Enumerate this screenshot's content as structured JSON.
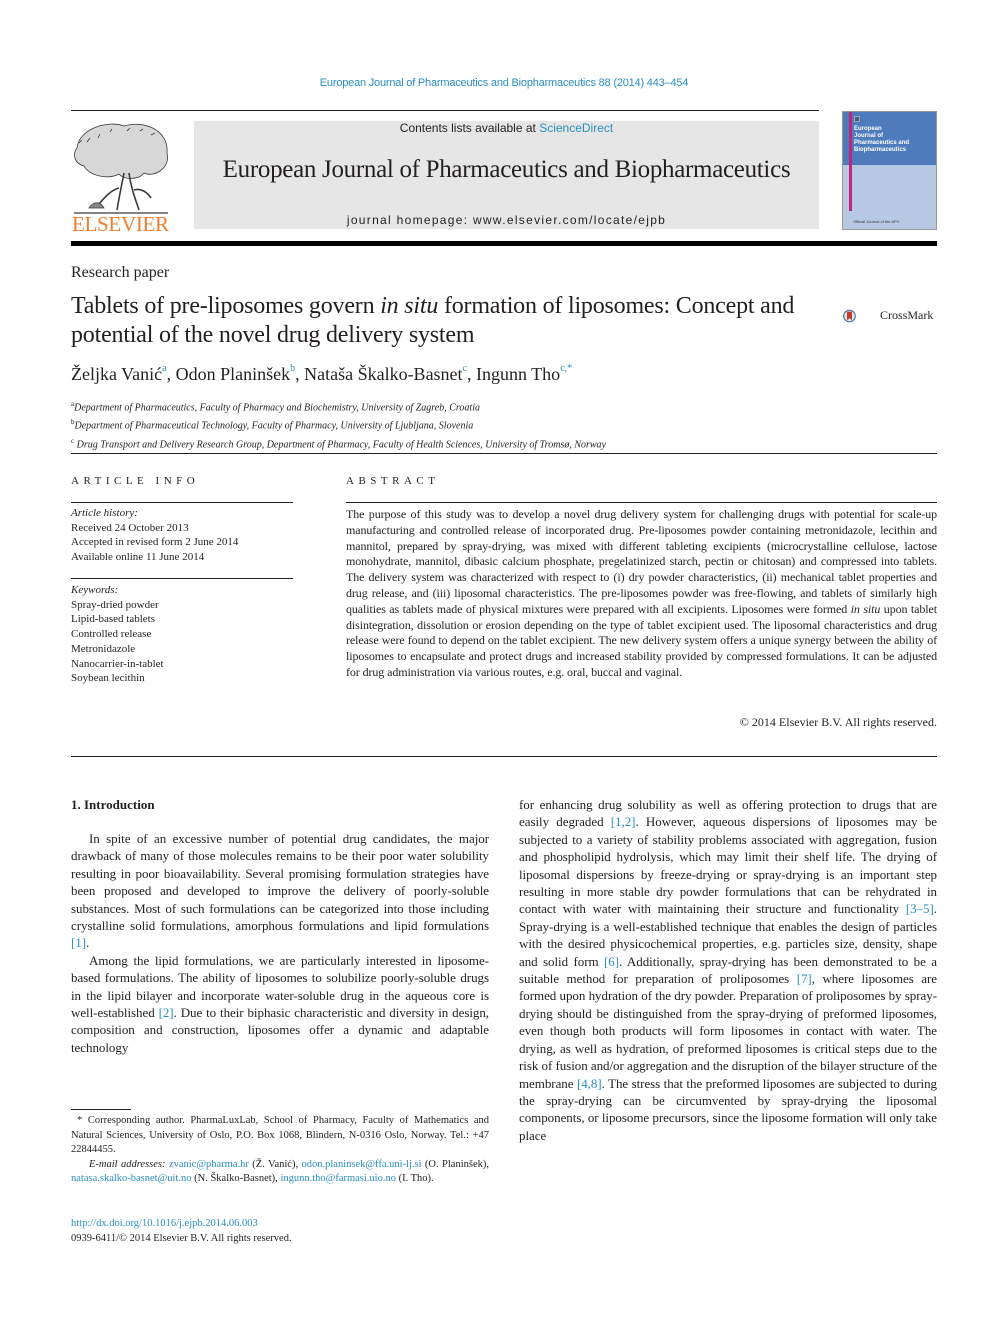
{
  "header": {
    "citation": "European Journal of Pharmaceutics and Biopharmaceutics 88 (2014) 443–454",
    "publisher": "ELSEVIER",
    "contents_prefix": "Contents lists available at ",
    "contents_link": "ScienceDirect",
    "journal_name": "European Journal of Pharmaceutics and Biopharmaceutics",
    "homepage_prefix": "journal homepage: ",
    "homepage_url": "www.elsevier.com/locate/ejpb",
    "cover_title_lines": [
      "European",
      "Journal of",
      "Pharmaceutics and",
      "Biopharmaceutics"
    ],
    "cover_footer": "Official Journal of the APV",
    "colors": {
      "link": "#2a8fc0",
      "elsevier_orange": "#f07f2e",
      "masthead_gray": "#e6e6e6"
    }
  },
  "article": {
    "type": "Research paper",
    "title_part1": "Tablets of pre-liposomes govern ",
    "title_italic": "in situ",
    "title_part2": " formation of liposomes: Concept and potential of the novel drug delivery system",
    "crossmark_label": "CrossMark",
    "authors": [
      {
        "name": "Željka Vanić",
        "sup": "a",
        "sep": ", "
      },
      {
        "name": "Odon Planinšek",
        "sup": "b",
        "sep": ", "
      },
      {
        "name": "Nataša Škalko-Basnet",
        "sup": "c",
        "sep": ", "
      },
      {
        "name": "Ingunn Tho",
        "sup": "c,*",
        "sep": ""
      }
    ],
    "affiliations": [
      {
        "key": "a",
        "text": "Department of Pharmaceutics, Faculty of Pharmacy and Biochemistry, University of Zagreb, Croatia"
      },
      {
        "key": "b",
        "text": "Department of Pharmaceutical Technology, Faculty of Pharmacy, University of Ljubljana, Slovenia"
      },
      {
        "key": "c",
        "text": "Drug Transport and Delivery Research Group, Department of Pharmacy, Faculty of Health Sciences, University of Tromsø, Norway"
      }
    ]
  },
  "article_info": {
    "heading": "ARTICLE INFO",
    "history_label": "Article history:",
    "history": [
      "Received 24 October 2013",
      "Accepted in revised form 2 June 2014",
      "Available online 11 June 2014"
    ],
    "keywords_label": "Keywords:",
    "keywords": [
      "Spray-dried powder",
      "Lipid-based tablets",
      "Controlled release",
      "Metronidazole",
      "Nanocarrier-in-tablet",
      "Soybean lecithin"
    ]
  },
  "abstract": {
    "heading": "ABSTRACT",
    "text_part1": "The purpose of this study was to develop a novel drug delivery system for challenging drugs with potential for scale-up manufacturing and controlled release of incorporated drug. Pre-liposomes powder containing metronidazole, lecithin and mannitol, prepared by spray-drying, was mixed with different tableting excipients (microcrystalline cellulose, lactose monohydrate, mannitol, dibasic calcium phosphate, pregelatinized starch, pectin or chitosan) and compressed into tablets. The delivery system was characterized with respect to (i) dry powder characteristics, (ii) mechanical tablet properties and drug release, and (iii) liposomal characteristics. The pre-liposomes powder was free-flowing, and tablets of similarly high qualities as tablets made of physical mixtures were prepared with all excipients. Liposomes were formed ",
    "text_italic": "in situ",
    "text_part2": " upon tablet disintegration, dissolution or erosion depending on the type of tablet excipient used. The liposomal characteristics and drug release were found to depend on the tablet excipient. The new delivery system offers a unique synergy between the ability of liposomes to encapsulate and protect drugs and increased stability provided by compressed formulations. It can be adjusted for drug administration via various routes, e.g. oral, buccal and vaginal.",
    "copyright": "© 2014 Elsevier B.V. All rights reserved."
  },
  "body": {
    "section_heading": "1. Introduction",
    "left_p1": [
      {
        "t": "In spite of an excessive number of potential drug candidates, the major drawback of many of those molecules remains to be their poor water solubility resulting in poor bioavailability. Several promising formulation strategies have been proposed and developed to improve the delivery of poorly-soluble substances. Most of such formulations can be categorized into those including crystalline solid formulations, amorphous formulations and lipid formulations "
      },
      {
        "ref": "[1]"
      },
      {
        "t": "."
      }
    ],
    "left_p2": [
      {
        "t": "Among the lipid formulations, we are particularly interested in liposome-based formulations. The ability of liposomes to solubilize poorly-soluble drugs in the lipid bilayer and incorporate water-soluble drug in the aqueous core is well-established "
      },
      {
        "ref": "[2]"
      },
      {
        "t": ". Due to their biphasic characteristic and diversity in design, composition and construction, liposomes offer a dynamic and adaptable technology"
      }
    ],
    "right_p1": [
      {
        "t": "for enhancing drug solubility as well as offering protection to drugs that are easily degraded "
      },
      {
        "ref": "[1,2]"
      },
      {
        "t": ". However, aqueous dispersions of liposomes may be subjected to a variety of stability problems associated with aggregation, fusion and phospholipid hydrolysis, which may limit their shelf life. The drying of liposomal dispersions by freeze-drying or spray-drying is an important step resulting in more stable dry powder formulations that can be rehydrated in contact with water with maintaining their structure and functionality "
      },
      {
        "ref": "[3–5]"
      },
      {
        "t": ". Spray-drying is a well-established technique that enables the design of particles with the desired physicochemical properties, e.g. particles size, density, shape and solid form "
      },
      {
        "ref": "[6]"
      },
      {
        "t": ". Additionally, spray-drying has been demonstrated to be a suitable method for preparation of proliposomes "
      },
      {
        "ref": "[7]"
      },
      {
        "t": ", where liposomes are formed upon hydration of the dry powder. Preparation of proliposomes by spray-drying should be distinguished from the spray-drying of preformed liposomes, even though both products will form liposomes in contact with water. The drying, as well as hydration, of preformed liposomes is critical steps due to the risk of fusion and/or aggregation and the disruption of the bilayer structure of the membrane "
      },
      {
        "ref": "[4,8]"
      },
      {
        "t": ". The stress that the preformed liposomes are subjected to during the spray-drying can be circumvented by spray-drying the liposomal components, or liposome precursors, since the liposome formation will only take place"
      }
    ]
  },
  "footnote": {
    "corresponding": "* Corresponding author. PharmaLuxLab, School of Pharmacy, Faculty of Mathematics and Natural Sciences, University of Oslo, P.O. Box 1068, Blindern, N-0316 Oslo, Norway. Tel.: +47 22844455.",
    "email_label": "E-mail addresses:",
    "emails": [
      {
        "email": "zvanic@pharma.hr",
        "who": " (Ž. Vanić), "
      },
      {
        "email": "odon.planinsek@ffa.uni-lj.si",
        "who": " (O. Planinšek), "
      },
      {
        "email": "natasa.skalko-basnet@uit.no",
        "who": " (N. Škalko-Basnet), "
      },
      {
        "email": "ingunn.tho@farmasi.uio.no",
        "who": " (I. Tho)."
      }
    ],
    "doi": "http://dx.doi.org/10.1016/j.ejpb.2014.06.003",
    "issn_copyright": "0939-6411/© 2014 Elsevier B.V. All rights reserved."
  }
}
